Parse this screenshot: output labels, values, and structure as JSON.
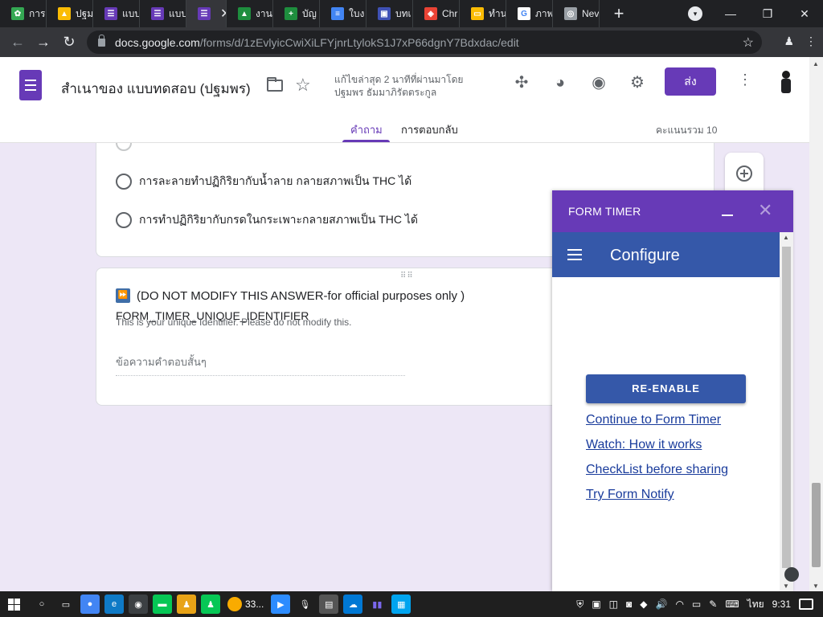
{
  "browser": {
    "tabs": [
      {
        "label": "การ",
        "color": "#34a853",
        "glyph": "✿"
      },
      {
        "label": "ปฐม",
        "color": "#fbbc04",
        "glyph": "▲"
      },
      {
        "label": "แบบ",
        "color": "#673ab7",
        "glyph": "☰"
      },
      {
        "label": "แบบ",
        "color": "#673ab7",
        "glyph": "☰"
      },
      {
        "label": "",
        "color": "#673ab7",
        "glyph": "☰",
        "active": true
      },
      {
        "label": "งาน",
        "color": "#1e8e3e",
        "glyph": "▲"
      },
      {
        "label": "บัญ",
        "color": "#1e8e3e",
        "glyph": "+"
      },
      {
        "label": "ใบง",
        "color": "#4285f4",
        "glyph": "≡"
      },
      {
        "label": "บทเ",
        "color": "#3f51b5",
        "glyph": "▣"
      },
      {
        "label": "Chr",
        "color": "#ea4335",
        "glyph": "◈"
      },
      {
        "label": "ทำน",
        "color": "#fbbc04",
        "glyph": "▭"
      },
      {
        "label": "ภาพ",
        "color": "#ffffff",
        "glyph": "G"
      },
      {
        "label": "Nev",
        "color": "#9aa0a6",
        "glyph": "◎"
      }
    ],
    "url_host": "docs.google.com",
    "url_path": "/forms/d/1zEvlyicCwiXiLFYjnrLtylokS1J7xP66dgnY7Bdxdac/edit"
  },
  "header": {
    "title": "สำเนาของ แบบทดสอบ (ปฐมพร)",
    "last_edit_line1": "แก้ไขล่าสุด 2 นาทีที่ผ่านมาโดย",
    "last_edit_line2": "ปฐมพร ธัมมาภิรัตตระกูล",
    "send_label": "ส่ง",
    "tab_questions": "คำถาม",
    "tab_responses": "การตอบกลับ",
    "total_score": "คะแนนรวม 10"
  },
  "question_card": {
    "options": [
      "การละลายทำปฏิกิริยากับน้ำลาย กลายสภาพเป็น THC ได้",
      "การทำปฏิกิริยากับกรดในกระเพาะกลายสภาพเป็น THC ได้"
    ]
  },
  "identifier_card": {
    "title": "(DO NOT MODIFY THIS ANSWER-for official purposes only )",
    "title_line2": "FORM_TIMER_UNIQUE_IDENTIFIER",
    "description": "This is your unique Identifier. Please do not modify this.",
    "answer_placeholder": "ข้อความคำตอบสั้นๆ"
  },
  "form_timer": {
    "header_title": "FORM TIMER",
    "appbar_title": "Configure",
    "reenable_label": "RE-ENABLE",
    "links": [
      "Continue to Form Timer",
      "Watch: How it works",
      "CheckList before sharing",
      "Try Form Notify"
    ]
  },
  "taskbar": {
    "weather_text": "33...",
    "language": "ไทย",
    "time": "9:31"
  }
}
